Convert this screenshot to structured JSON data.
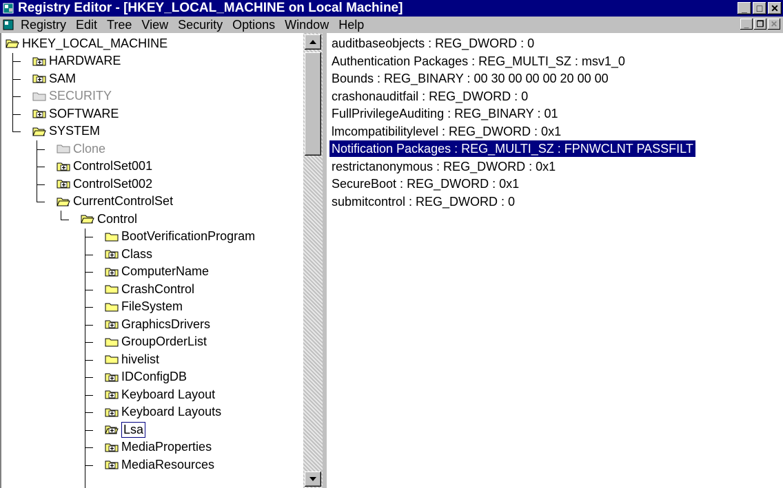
{
  "window": {
    "title": "Registry Editor - [HKEY_LOCAL_MACHINE on Local Machine]",
    "controls": {
      "minimize": "_",
      "maximize": "□",
      "close": "✕"
    }
  },
  "menubar": {
    "items": [
      "Registry",
      "Edit",
      "Tree",
      "View",
      "Security",
      "Options",
      "Window",
      "Help"
    ],
    "child_controls": {
      "minimize": "_",
      "restore": "❐",
      "close": "✕"
    }
  },
  "tree": {
    "nodes": [
      {
        "label": "HKEY_LOCAL_MACHINE",
        "icon": "open-folder-icon",
        "state": "expanded"
      },
      {
        "label": "HARDWARE",
        "icon": "folder-plus-icon"
      },
      {
        "label": "SAM",
        "icon": "folder-plus-icon"
      },
      {
        "label": "SECURITY",
        "icon": "folder-icon",
        "grayed": true
      },
      {
        "label": "SOFTWARE",
        "icon": "folder-plus-icon"
      },
      {
        "label": "SYSTEM",
        "icon": "open-folder-icon",
        "state": "expanded"
      },
      {
        "label": "Clone",
        "icon": "folder-icon",
        "grayed": true
      },
      {
        "label": "ControlSet001",
        "icon": "folder-plus-icon"
      },
      {
        "label": "ControlSet002",
        "icon": "folder-plus-icon"
      },
      {
        "label": "CurrentControlSet",
        "icon": "open-folder-icon",
        "state": "expanded"
      },
      {
        "label": "Control",
        "icon": "open-folder-icon",
        "state": "expanded"
      },
      {
        "label": "BootVerificationProgram",
        "icon": "folder-icon"
      },
      {
        "label": "Class",
        "icon": "folder-plus-icon"
      },
      {
        "label": "ComputerName",
        "icon": "folder-plus-icon"
      },
      {
        "label": "CrashControl",
        "icon": "folder-icon"
      },
      {
        "label": "FileSystem",
        "icon": "folder-icon"
      },
      {
        "label": "GraphicsDrivers",
        "icon": "folder-plus-icon"
      },
      {
        "label": "GroupOrderList",
        "icon": "folder-icon"
      },
      {
        "label": "hivelist",
        "icon": "folder-icon"
      },
      {
        "label": "IDConfigDB",
        "icon": "folder-plus-icon"
      },
      {
        "label": "Keyboard Layout",
        "icon": "folder-plus-icon"
      },
      {
        "label": "Keyboard Layouts",
        "icon": "folder-plus-icon"
      },
      {
        "label": "Lsa",
        "icon": "open-folder-plus-icon",
        "selected": true
      },
      {
        "label": "MediaProperties",
        "icon": "folder-plus-icon"
      },
      {
        "label": "MediaResources",
        "icon": "folder-plus-icon"
      }
    ]
  },
  "values": {
    "rows": [
      "auditbaseobjects : REG_DWORD : 0",
      "Authentication Packages : REG_MULTI_SZ : msv1_0",
      "Bounds : REG_BINARY : 00 30 00 00 00 20 00 00",
      "crashonauditfail : REG_DWORD : 0",
      "FullPrivilegeAuditing : REG_BINARY : 01",
      "lmcompatibilitylevel : REG_DWORD : 0x1",
      "Notification Packages : REG_MULTI_SZ : FPNWCLNT PASSFILT",
      "restrictanonymous : REG_DWORD : 0x1",
      "SecureBoot : REG_DWORD : 0x1",
      "submitcontrol : REG_DWORD : 0"
    ],
    "selected_row": "Notification Packages : REG_MULTI_SZ : FPNWCLNT PASSFILT"
  },
  "colors": {
    "titlebar": "#000080",
    "selection": "#000080",
    "chrome": "#c0c0c0",
    "folder": "#ffff80"
  }
}
